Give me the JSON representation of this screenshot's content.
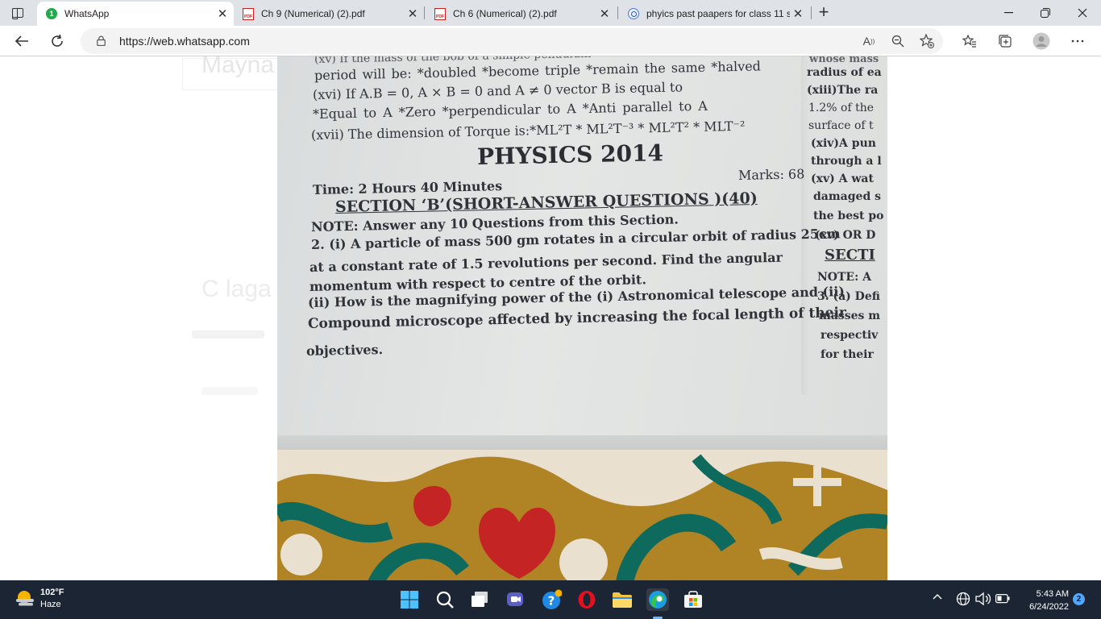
{
  "browser": {
    "tabs": [
      {
        "title": "WhatsApp",
        "favicon": "whatsapp-icon",
        "badge": "1",
        "active": true
      },
      {
        "title": "Ch 9 (Numerical) (2).pdf",
        "favicon": "pdf-icon",
        "active": false
      },
      {
        "title": "Ch 6 (Numerical) (2).pdf",
        "favicon": "pdf-icon",
        "active": false
      },
      {
        "title": "phyics past paapers for class 11 s",
        "favicon": "search-icon",
        "active": false
      }
    ],
    "url": "https://web.whatsapp.com"
  },
  "page": {
    "ghost_name": "Mayna",
    "ghost_message": "C laga",
    "scan_lines": {
      "l1": "(xv) If the mass of the bob of a simple pendulum",
      "l2": "period will be: *doubled   *become triple   *remain the same   *halved",
      "l3": "(xvi) If A.B = 0, A × B = 0 and A ≠ 0 vector B is equal to",
      "l4": "*Equal to A        *Zero  *perpendicular to A      *Anti parallel to A",
      "l5": "(xvii) The dimension of Torque is:*ML²T * ML²T⁻³ * ML²T² * MLT⁻²",
      "heading": "PHYSICS 2014",
      "marks": "Marks: 68",
      "time": "Time: 2 Hours 40 Minutes",
      "section": "SECTION ‘B’(SHORT-ANSWER QUESTIONS )(40)",
      "note": "NOTE: Answer any 10 Questions from this Section.",
      "q2a": "2. (i) A particle of mass 500 gm rotates in a circular orbit of radius 25cm",
      "q2b": "at a constant rate of 1.5 revolutions per second. Find the angular",
      "q2c": "momentum with respect to centre of the orbit.",
      "q2d": "(ii) How is the magnifying power of the (i) Astronomical telescope and (ii)",
      "q2e": "Compound microscope affected by increasing the focal length of their",
      "q2f": "objectives.",
      "r1": "whose mass",
      "r2": "radius of ea",
      "r3": "(xiii)The ra",
      "r4": "1.2% of the",
      "r5": "surface of t",
      "r6": "(xiv)A pun",
      "r7": "through a l",
      "r8": "(xv) A wat",
      "r9": "damaged s",
      "r10": "the best po",
      "r11": "(xv) OR D",
      "r12": "SECTI",
      "r13": "NOTE: A",
      "r14": "3. (a) Defi",
      "r15": "masses m",
      "r16": "respectiv",
      "r17": "for their"
    }
  },
  "taskbar": {
    "weather_temp": "102°F",
    "weather_desc": "Haze",
    "time": "5:43 AM",
    "date": "6/24/2022",
    "notifications": "2"
  },
  "colors": {
    "tabstrip": "#dfe3e8",
    "taskbar": "#1c2533",
    "whatsapp_green": "#1faa4b"
  }
}
